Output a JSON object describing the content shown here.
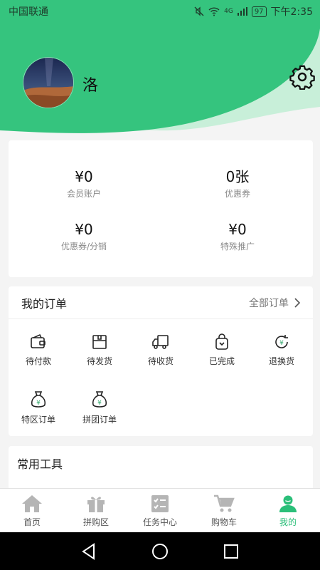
{
  "status_bar": {
    "carrier": "中国联通",
    "network": "4G",
    "battery": "97",
    "time": "下午2:35"
  },
  "profile": {
    "username": "洛"
  },
  "colors": {
    "accent": "#2bbf79",
    "header_green": "#35c47e",
    "header_light": "#c8efd9"
  },
  "balance": {
    "items": [
      {
        "value": "¥0",
        "label": "会员账户"
      },
      {
        "value": "0张",
        "label": "优惠券"
      },
      {
        "value": "¥0",
        "label": "优惠券/分销"
      },
      {
        "value": "¥0",
        "label": "特殊推广"
      }
    ]
  },
  "orders": {
    "title": "我的订单",
    "all_label": "全部订单",
    "items": [
      {
        "label": "待付款",
        "icon": "wallet-icon"
      },
      {
        "label": "待发货",
        "icon": "box-icon"
      },
      {
        "label": "待收货",
        "icon": "truck-icon"
      },
      {
        "label": "已完成",
        "icon": "bag-check-icon"
      },
      {
        "label": "退换货",
        "icon": "refund-icon"
      },
      {
        "label": "特区订单",
        "icon": "money-bag-icon"
      },
      {
        "label": "拼团订单",
        "icon": "money-bag-icon"
      }
    ]
  },
  "tools": {
    "title": "常用工具"
  },
  "tabbar": {
    "items": [
      {
        "label": "首页",
        "icon": "home-icon"
      },
      {
        "label": "拼购区",
        "icon": "gift-icon"
      },
      {
        "label": "任务中心",
        "icon": "task-list-icon"
      },
      {
        "label": "购物车",
        "icon": "cart-icon"
      },
      {
        "label": "我的",
        "icon": "user-icon",
        "active": true
      }
    ]
  }
}
